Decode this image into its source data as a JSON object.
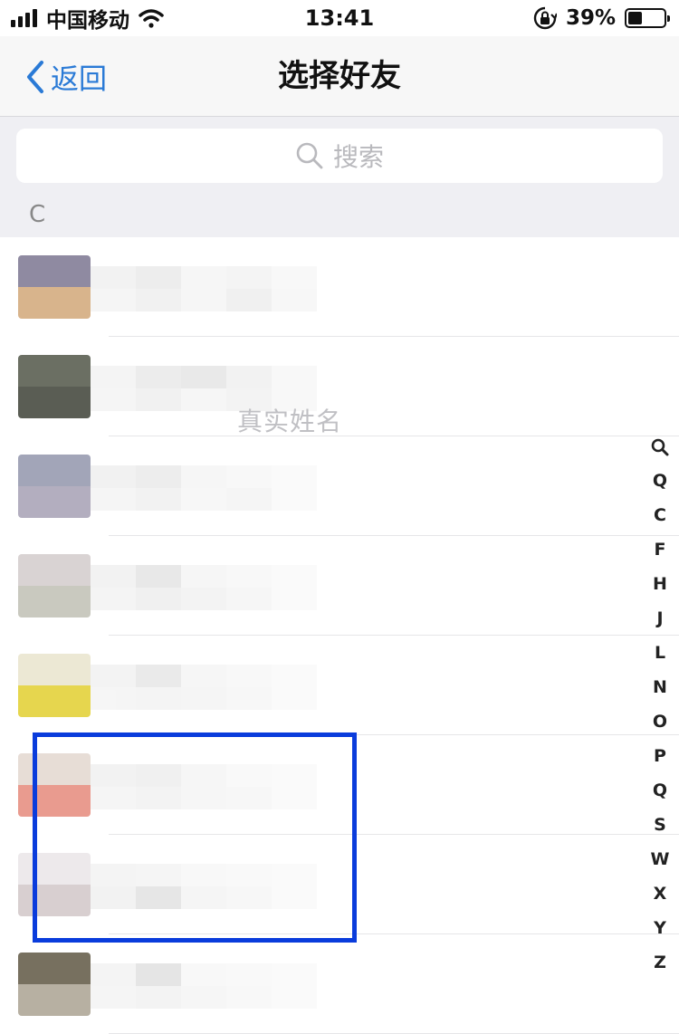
{
  "status_bar": {
    "carrier": "中国移动",
    "time": "13:41",
    "battery_percent": "39%",
    "battery_level": 0.39,
    "signal_bars": 4
  },
  "nav": {
    "back_label": "返回",
    "title": "选择好友"
  },
  "search": {
    "placeholder": "搜索"
  },
  "section": {
    "letter": "C"
  },
  "contacts": [
    {
      "avatar_colors": [
        "#8f8aa1",
        "#d8b48c"
      ],
      "name_colors": [
        "#f1f1f1",
        "#ececec",
        "#f6f6f6",
        "#f3f3f3",
        "#f8f8f8",
        "#f4f4f4",
        "#f0f0f0",
        "#f6f6f6",
        "#efefef",
        "#f7f7f7"
      ],
      "subtitle": ""
    },
    {
      "avatar_colors": [
        "#6b6f63",
        "#5a5d54"
      ],
      "name_colors": [
        "#f3f3f3",
        "#eaeaea",
        "#e7e7e7",
        "#f1f1f1",
        "#f8f8f8",
        "#f5f5f5",
        "#f0f0f0",
        "#f6f6f6",
        "#f2f2f2",
        "#f8f8f8"
      ],
      "subtitle": "真实姓名"
    },
    {
      "avatar_colors": [
        "#a2a5b8",
        "#b3aebf"
      ],
      "name_colors": [
        "#f0f0f0",
        "#ececec",
        "#f6f6f6",
        "#f8f8f8",
        "#fafafa",
        "#f4f4f4",
        "#f1f1f1",
        "#f7f7f7",
        "#f5f5f5",
        "#fafafa"
      ],
      "subtitle": ""
    },
    {
      "avatar_colors": [
        "#d9d3d3",
        "#c9c9bf"
      ],
      "name_colors": [
        "#f1f1f1",
        "#e6e6e6",
        "#f6f6f6",
        "#f8f8f8",
        "#fafafa",
        "#f3f3f3",
        "#efefef",
        "#f2f2f2",
        "#f6f6f6",
        "#fafafa"
      ],
      "subtitle": ""
    },
    {
      "avatar_colors": [
        "#ece8d4",
        "#e6d64e"
      ],
      "name_colors": [
        "#f2f2f2",
        "#e8e8e8",
        "#f6f6f6",
        "#f8f8f8",
        "#fafafa",
        "#f5f5f5",
        "#f3f3f3",
        "#f5f5f5",
        "#f7f7f7",
        "#fafafa"
      ],
      "subtitle": ""
    },
    {
      "avatar_colors": [
        "#e7ddd6",
        "#e99b8f"
      ],
      "name_colors": [
        "#f1f1f1",
        "#efefef",
        "#f6f6f6",
        "#f9f9f9",
        "#fafafa",
        "#f4f4f4",
        "#f2f2f2",
        "#f6f6f6",
        "#f7f7f7",
        "#fafafa"
      ],
      "subtitle": ""
    },
    {
      "avatar_colors": [
        "#ede9eb",
        "#d8cfd0"
      ],
      "name_colors": [
        "#f3f3f3",
        "#f5f5f5",
        "#f8f8f8",
        "#f9f9f9",
        "#fafafa",
        "#f1f1f1",
        "#e4e4e4",
        "#f5f5f5",
        "#f7f7f7",
        "#fafafa"
      ],
      "subtitle": ""
    },
    {
      "avatar_colors": [
        "#77705f",
        "#b7b0a2"
      ],
      "name_colors": [
        "#f3f3f3",
        "#e3e3e3",
        "#f8f8f8",
        "#f9f9f9",
        "#fafafa",
        "#f4f4f4",
        "#f2f2f2",
        "#f6f6f6",
        "#f8f8f8",
        "#fafafa"
      ],
      "subtitle": ""
    }
  ],
  "index_bar": {
    "letters": [
      "Q",
      "C",
      "F",
      "H",
      "J",
      "L",
      "N",
      "O",
      "P",
      "Q",
      "S",
      "W",
      "X",
      "Y",
      "Z"
    ]
  },
  "colors": {
    "accent": "#2a7ad6",
    "highlight_border": "#0a3cdc",
    "section_bg": "#efeff3"
  }
}
